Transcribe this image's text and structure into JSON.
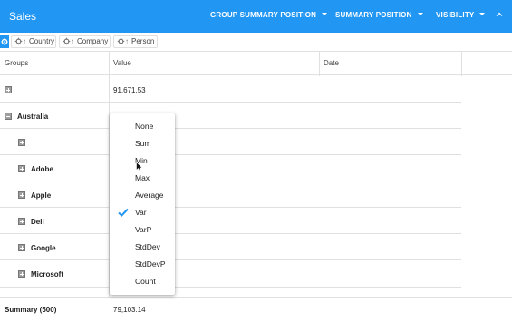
{
  "toolbar": {
    "title": "Sales",
    "buttons": [
      "GROUP SUMMARY POSITION",
      "SUMMARY POSITION",
      "VISIBILITY"
    ],
    "accent": "#2196f3"
  },
  "group_panel": {
    "chips": [
      "Country",
      "Company",
      "Person"
    ]
  },
  "columns": [
    "Groups",
    "Value",
    "Date"
  ],
  "rows": [
    {
      "type": "group",
      "label": "",
      "value": "91,671.53"
    },
    {
      "type": "group-expanded",
      "label": "Australia",
      "value": ""
    },
    {
      "type": "subgroup",
      "label": "",
      "value": ""
    },
    {
      "type": "subgroup",
      "label": "Adobe",
      "value": ""
    },
    {
      "type": "subgroup",
      "label": "Apple",
      "value": ""
    },
    {
      "type": "subgroup",
      "label": "Dell",
      "value": ""
    },
    {
      "type": "subgroup",
      "label": "Google",
      "value": ""
    },
    {
      "type": "subgroup",
      "label": "Microsoft",
      "value": ""
    }
  ],
  "summary_menu": {
    "items": [
      "None",
      "Sum",
      "Min",
      "Max",
      "Average",
      "Var",
      "VarP",
      "StdDev",
      "StdDevP",
      "Count"
    ],
    "selected": "Var"
  },
  "footer": {
    "label": "Summary (500)",
    "value": "79,103.14"
  }
}
